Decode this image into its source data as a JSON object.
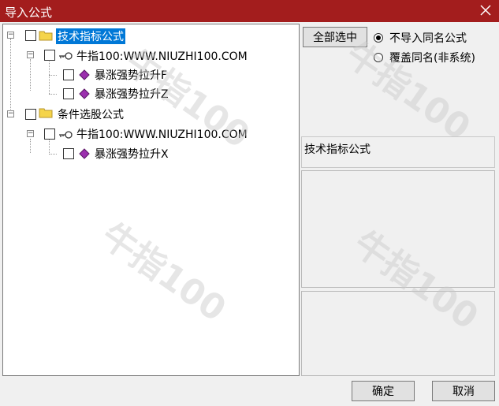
{
  "window": {
    "title": "导入公式"
  },
  "tree": {
    "group1": {
      "label": "技术指标公式"
    },
    "group1_child": {
      "label": "牛指100:WWW.NIUZHI100.COM"
    },
    "group1_items": [
      {
        "label": "暴涨强势拉升F"
      },
      {
        "label": "暴涨强势拉升Z"
      }
    ],
    "group2": {
      "label": "条件选股公式"
    },
    "group2_child": {
      "label": "牛指100:WWW.NIUZHI100.COM"
    },
    "group2_items": [
      {
        "label": "暴涨强势拉升X"
      }
    ]
  },
  "options": {
    "select_all_label": "全部选中",
    "radio_skip_label": "不导入同名公式",
    "radio_overwrite_label": "覆盖同名(非系统)",
    "selected": "radio_skip"
  },
  "info": {
    "category_label": "技术指标公式"
  },
  "footer": {
    "ok_label": "确定",
    "cancel_label": "取消"
  },
  "watermark": {
    "text": "牛指100"
  },
  "colors": {
    "titlebar": "#a31d1d",
    "selection": "#0078d7",
    "formula_icon": "#9b2fae"
  }
}
